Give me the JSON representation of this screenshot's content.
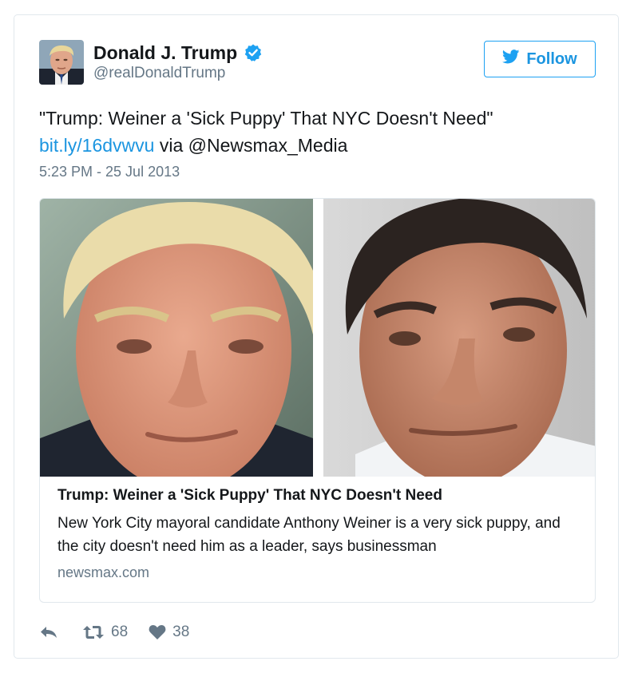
{
  "author": {
    "name": "Donald J. Trump",
    "handle": "@realDonaldTrump",
    "verified": true
  },
  "follow_button": {
    "label": "Follow",
    "icon": "twitter-bird-icon"
  },
  "tweet": {
    "text_quote": "\"Trump: Weiner a 'Sick Puppy' That NYC Doesn't Need\"",
    "link_text": "bit.ly/16dvwvu",
    "via_text": " via @Newsmax_Media",
    "timestamp": "5:23 PM - 25 Jul 2013"
  },
  "card": {
    "title": "Trump: Weiner a 'Sick Puppy' That NYC Doesn't Need",
    "description": "New York City mayoral candidate Anthony Weiner is a very sick puppy, and the city doesn't need him as a leader, says businessman",
    "domain": "newsmax.com"
  },
  "actions": {
    "reply_icon": "reply-icon",
    "retweet_icon": "retweet-icon",
    "retweet_count": "68",
    "like_icon": "heart-icon",
    "like_count": "38"
  },
  "colors": {
    "accent": "#1da1f2",
    "link": "#1b95e0",
    "text": "#14171a",
    "muted": "#657786",
    "border": "#e1e8ed"
  }
}
